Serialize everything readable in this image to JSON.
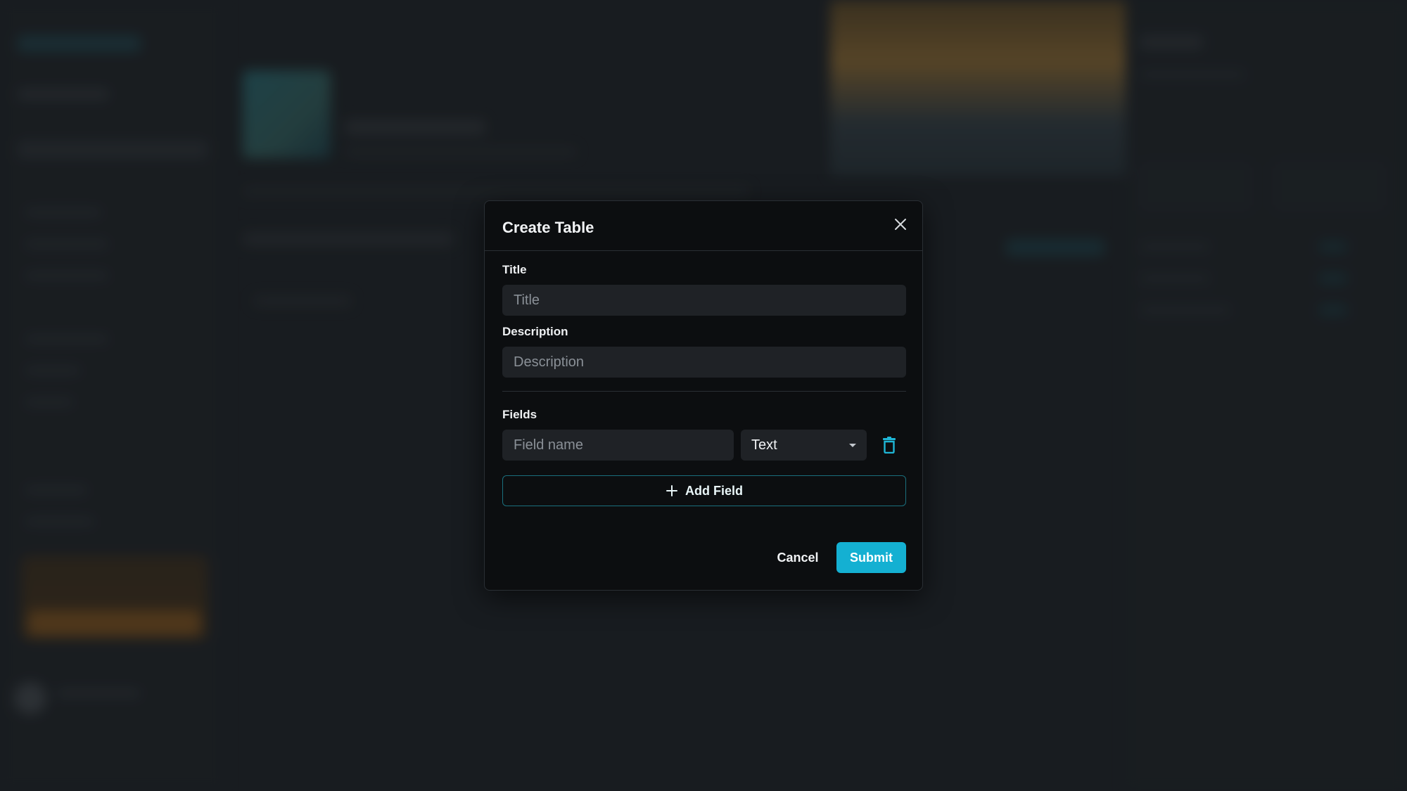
{
  "modal": {
    "title": "Create Table",
    "title_field": {
      "label": "Title",
      "placeholder": "Title",
      "value": ""
    },
    "description_field": {
      "label": "Description",
      "placeholder": "Description",
      "value": ""
    },
    "fields_section": {
      "label": "Fields",
      "rows": [
        {
          "name_placeholder": "Field name",
          "type_value": "Text"
        }
      ],
      "add_field_label": "Add Field"
    },
    "actions": {
      "cancel_label": "Cancel",
      "submit_label": "Submit"
    }
  },
  "colors": {
    "accent": "#14b0d2",
    "modal_bg": "#0c0e10",
    "input_bg": "#1f2226",
    "page_bg": "#1d2125",
    "add_field_border": "#1a6f7d"
  },
  "icons": {
    "close": "close-icon",
    "delete": "trash-icon",
    "add": "plus-icon",
    "dropdown": "chevron-down-icon"
  }
}
